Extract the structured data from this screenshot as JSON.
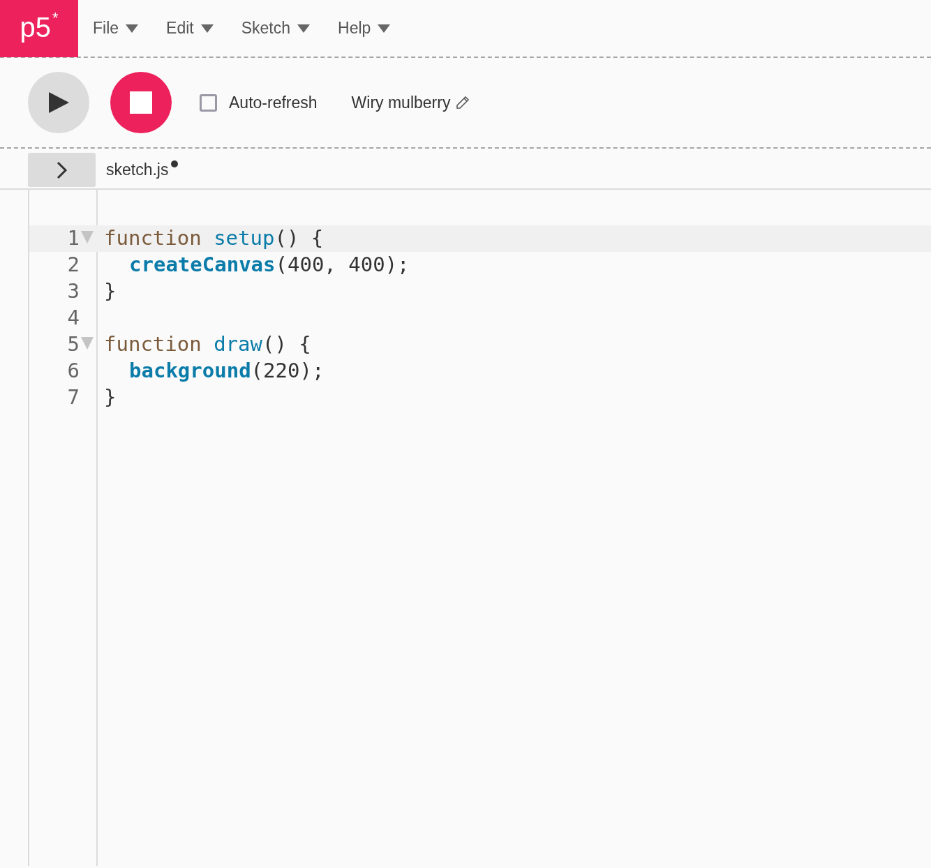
{
  "logo": {
    "text": "p5",
    "mark": "*"
  },
  "menu": [
    {
      "label": "File"
    },
    {
      "label": "Edit"
    },
    {
      "label": "Sketch"
    },
    {
      "label": "Help"
    }
  ],
  "toolbar": {
    "playing": true,
    "auto_refresh": {
      "label": "Auto-refresh",
      "checked": false
    },
    "sketch_name": "Wiry mulberry"
  },
  "tabs": [
    {
      "label": "sketch.js",
      "unsaved": true,
      "selected": true
    }
  ],
  "sidebar": {
    "expanded": false
  },
  "editor": {
    "lines": [
      {
        "number": "1",
        "foldable": true,
        "active": true,
        "tokens": [
          {
            "text": "function",
            "kind": "keyword"
          },
          {
            "text": "setup",
            "kind": "def"
          },
          {
            "text": "() {",
            "kind": "plain"
          }
        ]
      },
      {
        "number": "2",
        "indent": true,
        "tokens": [
          {
            "text": "createCanvas",
            "kind": "builtin"
          },
          {
            "text": "(400, 400);",
            "kind": "plain"
          }
        ]
      },
      {
        "number": "3",
        "tokens": [
          {
            "text": "}",
            "kind": "plain"
          }
        ]
      },
      {
        "number": "4"
      },
      {
        "number": "5",
        "foldable": true,
        "tokens": [
          {
            "text": "function",
            "kind": "keyword"
          },
          {
            "text": "draw",
            "kind": "def"
          },
          {
            "text": "() {",
            "kind": "plain"
          }
        ]
      },
      {
        "number": "6",
        "indent": true,
        "tokens": [
          {
            "text": "background",
            "kind": "builtin"
          },
          {
            "text": "(220);",
            "kind": "plain"
          }
        ]
      },
      {
        "number": "7",
        "tokens": [
          {
            "text": "}",
            "kind": "plain"
          }
        ]
      }
    ]
  }
}
